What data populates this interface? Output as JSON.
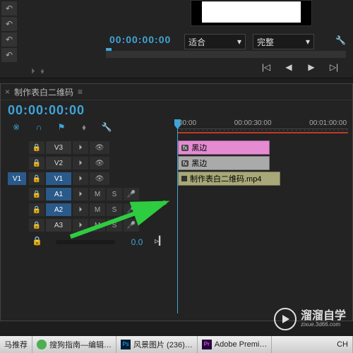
{
  "top": {
    "timecode": "00:00:00:00",
    "fit_dropdown": "适合",
    "zoom_dropdown": "完整"
  },
  "sequence": {
    "tab_title": "制作表白二维码",
    "tab_menu": "≡",
    "timecode": "00:00:00:00",
    "ruler": [
      "00:00",
      "00:00:30:00",
      "00:01:00:00"
    ],
    "slider_value": "0.0"
  },
  "tracks": {
    "v3": {
      "label": "V3"
    },
    "v2": {
      "label": "V2"
    },
    "v1": {
      "label": "V1",
      "target": "V1"
    },
    "a1": {
      "label": "A1",
      "m": "M",
      "s": "S"
    },
    "a2": {
      "label": "A2",
      "m": "M",
      "s": "S"
    },
    "a3": {
      "label": "A3",
      "m": "M",
      "s": "S"
    }
  },
  "clips": {
    "c1": {
      "fx": "fx",
      "name": "黑边"
    },
    "c2": {
      "fx": "fx",
      "name": "黑边"
    },
    "c3": {
      "name": "制作表白二维码.mp4"
    }
  },
  "watermark": {
    "title": "溜溜自学",
    "sub": "zixue.3d66.com"
  },
  "taskbar": {
    "item1": "马推荐",
    "item2": "搜狗指南—编辑…",
    "item3": "风景图片 (236)…",
    "item4": "Adobe Premi…",
    "lang": "CH"
  },
  "icons": {
    "undo": "↶",
    "lock": "🔒",
    "sync": "⏵",
    "eye": "👁",
    "mic": "🎤",
    "wrench": "🔧",
    "snap": "※",
    "magnet": "∩",
    "marker": "⚑",
    "tag": "⬧",
    "chev": "▾",
    "skip_end": "▹|",
    "play": "▶",
    "prev": "◀",
    "rew": "|◁",
    "fwd": "▷|",
    "jump": "▹▎"
  }
}
